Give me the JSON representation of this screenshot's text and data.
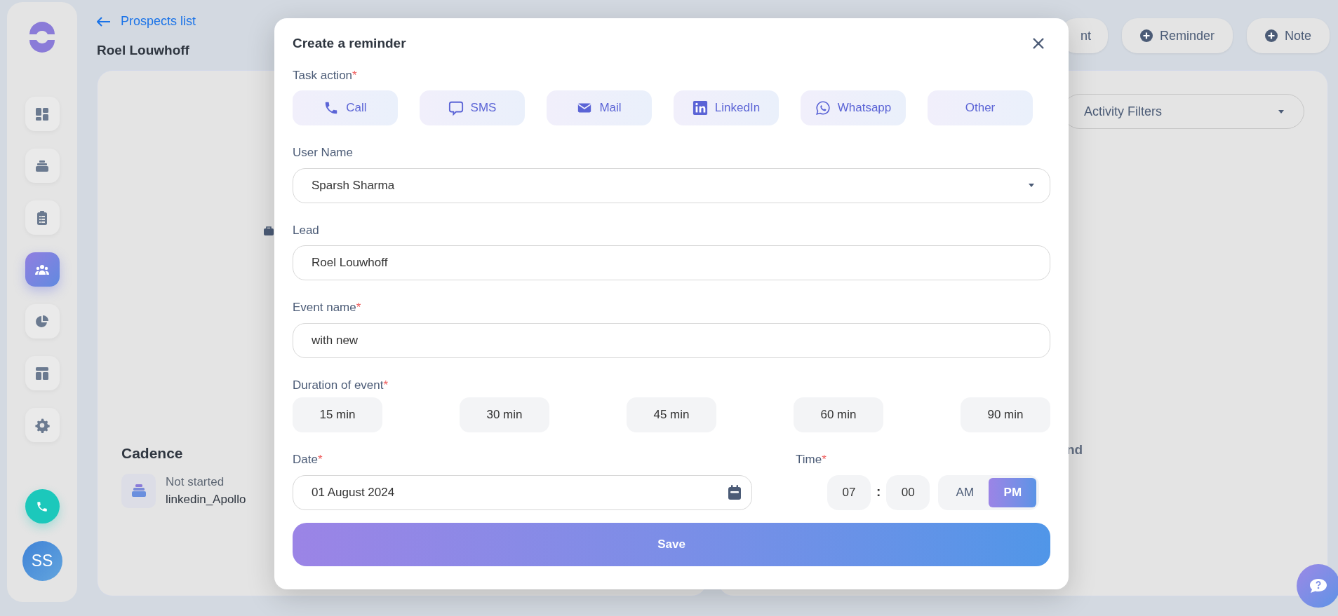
{
  "sidebar": {
    "items": [
      {
        "kind": "dashboard",
        "selected": false
      },
      {
        "kind": "stack",
        "selected": false
      },
      {
        "kind": "clipboard",
        "selected": false
      },
      {
        "kind": "people",
        "selected": true
      },
      {
        "kind": "pie",
        "selected": false
      },
      {
        "kind": "layout",
        "selected": false
      },
      {
        "kind": "settings",
        "selected": false
      }
    ],
    "avatar": "SS"
  },
  "header": {
    "back_link": "Prospects list",
    "title": "Roel Louwhoff",
    "actions": [
      {
        "label": "nt",
        "kind": "cut"
      },
      {
        "label": "Reminder",
        "kind": "add"
      },
      {
        "label": "Note",
        "kind": "add"
      }
    ]
  },
  "activity_filter": {
    "label": "Activity Filters"
  },
  "cadence": {
    "title": "Cadence",
    "status": "Not started",
    "name": "linkedin_Apollo"
  },
  "right_card_text": "nd",
  "modal": {
    "title": "Create a reminder",
    "task_action": {
      "label": "Task action",
      "required_mark": "*",
      "options": [
        {
          "label": "Call",
          "kind": "call"
        },
        {
          "label": "SMS",
          "kind": "sms"
        },
        {
          "label": "Mail",
          "kind": "mail"
        },
        {
          "label": "LinkedIn",
          "kind": "linkedin"
        },
        {
          "label": "Whatsapp",
          "kind": "whatsapp"
        },
        {
          "label": "Other",
          "kind": "other"
        }
      ]
    },
    "user_name": {
      "label": "User Name",
      "value": "Sparsh Sharma"
    },
    "lead": {
      "label": "Lead",
      "value": "Roel Louwhoff"
    },
    "event_name": {
      "label": "Event name",
      "required_mark": "*",
      "value": "with new"
    },
    "duration": {
      "label": "Duration of event",
      "required_mark": "*",
      "options": [
        {
          "label": "15 min",
          "selected": false
        },
        {
          "label": "30 min",
          "selected": false
        },
        {
          "label": "45 min",
          "selected": false
        },
        {
          "label": "60 min",
          "selected": false
        },
        {
          "label": "90 min",
          "selected": false
        }
      ]
    },
    "date": {
      "label": "Date",
      "required_mark": "*",
      "value": "01 August 2024"
    },
    "time": {
      "label": "Time",
      "required_mark": "*",
      "hour": "07",
      "separator": ":",
      "minute": "00",
      "meridiem": [
        {
          "label": "AM",
          "selected": false
        },
        {
          "label": "PM",
          "selected": true
        }
      ]
    },
    "save": "Save"
  }
}
